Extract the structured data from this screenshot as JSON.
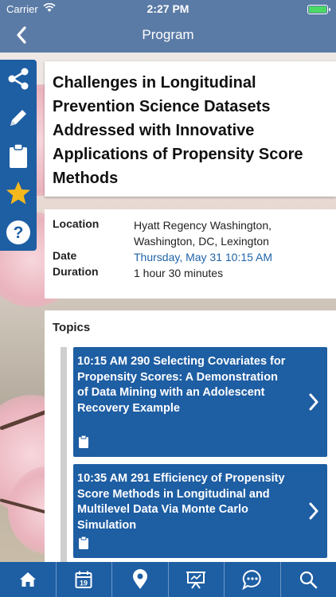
{
  "status_bar": {
    "carrier": "Carrier",
    "time": "2:27 PM"
  },
  "nav": {
    "title": "Program"
  },
  "session": {
    "title": "Challenges in Longitudinal Prevention Science Datasets Addressed with Innovative Applications of Propensity Score Methods"
  },
  "details": {
    "location_label": "Location",
    "location_value": "Hyatt Regency Washington, Washington, DC, Lexington",
    "date_label": "Date",
    "date_value": "Thursday, May 31 10:15 AM",
    "duration_label": "Duration",
    "duration_value": "1 hour 30 minutes"
  },
  "topics": {
    "heading": "Topics",
    "items": [
      {
        "text": "10:15 AM  290 Selecting Covariates for Propensity Scores: A Demonstration of Data Mining with an Adolescent Recovery Example"
      },
      {
        "text": "10:35 AM  291 Efficiency of Propensity Score Methods in Longitudinal and Multilevel Data Via Monte Carlo Simulation"
      }
    ]
  },
  "side_toolbar": [
    "share-icon",
    "pencil-icon",
    "clipboard-icon",
    "star-icon",
    "help-icon"
  ],
  "tab_bar": [
    "home-icon",
    "calendar-icon",
    "map-pin-icon",
    "presentation-icon",
    "chat-icon",
    "search-icon"
  ],
  "tab_calendar_day": "19",
  "colors": {
    "nav": "#5a7ba6",
    "primary": "#1e5ea3",
    "star": "#f5b81c",
    "link": "#1f63a8",
    "battery": "#4cd964"
  }
}
